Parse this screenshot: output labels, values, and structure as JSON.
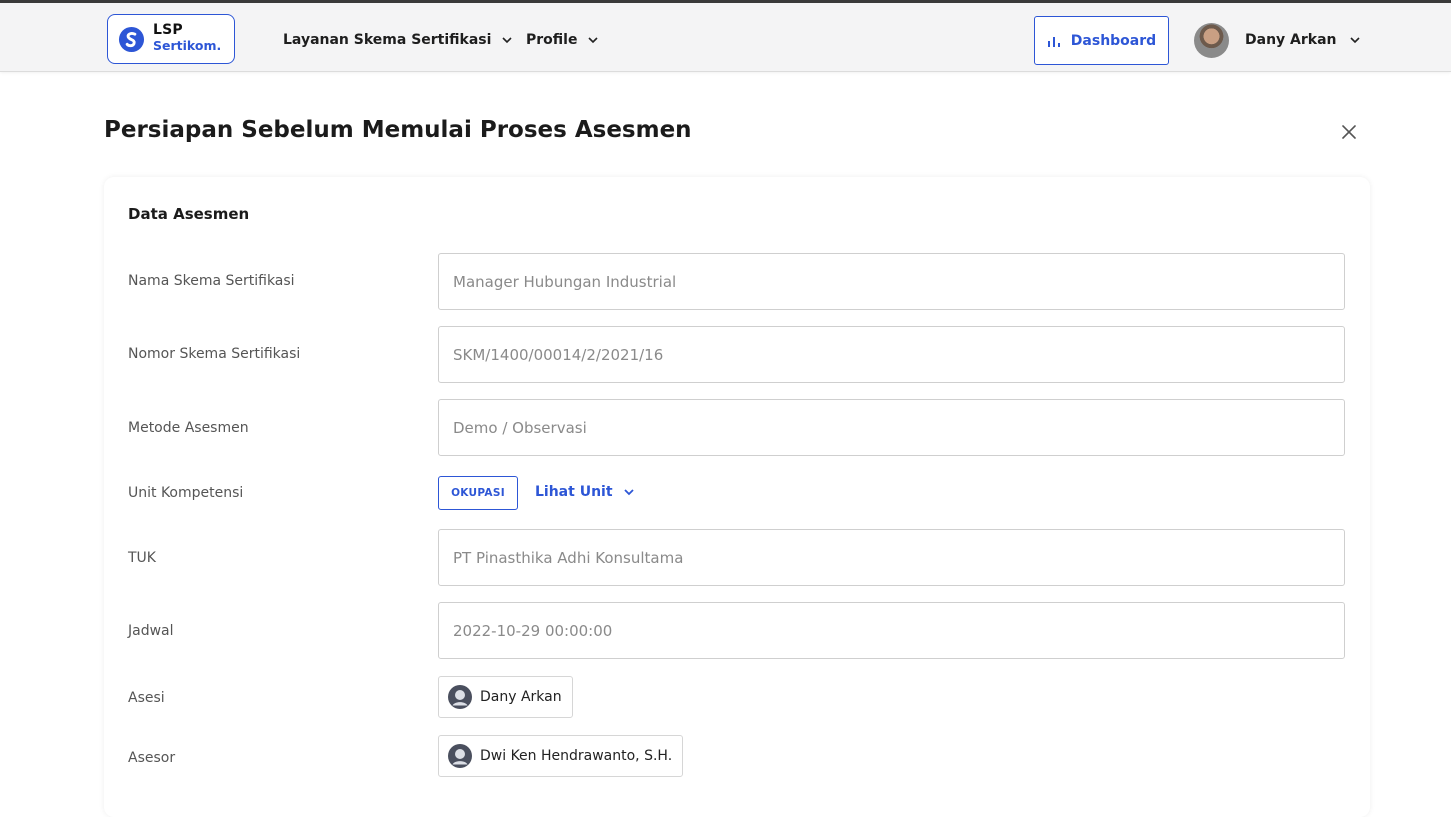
{
  "brand": {
    "line1": "LSP",
    "line2": "Sertikom."
  },
  "nav": [
    {
      "label": "Layanan Skema Sertifikasi"
    },
    {
      "label": "Profile"
    }
  ],
  "header": {
    "dashboard_label": "Dashboard",
    "user_name": "Dany Arkan"
  },
  "page": {
    "title": "Persiapan Sebelum Memulai Proses Asesmen"
  },
  "card": {
    "title": "Data Asesmen",
    "fields": {
      "nama_skema": {
        "label": "Nama Skema Sertifikasi",
        "value": "Manager Hubungan Industrial"
      },
      "nomor_skema": {
        "label": "Nomor Skema Sertifikasi",
        "value": "SKM/1400/00014/2/2021/16"
      },
      "metode": {
        "label": "Metode Asesmen",
        "value": "Demo / Observasi"
      },
      "unit": {
        "label": "Unit Kompetensi",
        "badge": "OKUPASI",
        "link": "Lihat Unit"
      },
      "tuk": {
        "label": "TUK",
        "value": "PT Pinasthika Adhi Konsultama"
      },
      "jadwal": {
        "label": "Jadwal",
        "value": "2022-10-29 00:00:00"
      },
      "asesi": {
        "label": "Asesi",
        "value": "Dany Arkan"
      },
      "asesor": {
        "label": "Asesor",
        "value": "Dwi Ken Hendrawanto, S.H."
      }
    }
  },
  "colors": {
    "accent": "#2d56d6",
    "border": "#cfcfcf",
    "muted_text": "#8a8a8a"
  },
  "icons": [
    "logo-mark-icon",
    "chevron-down-icon",
    "bar-chart-icon",
    "close-icon",
    "user-icon"
  ]
}
